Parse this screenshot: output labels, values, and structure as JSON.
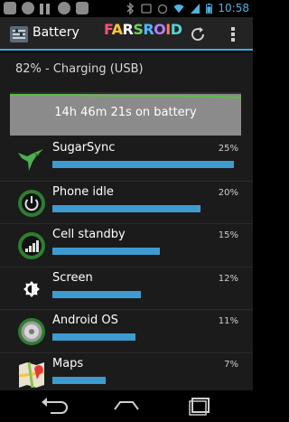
{
  "status_bar": {
    "time": "10:58",
    "colors": {
      "time": "#4fb3e0"
    }
  },
  "action_bar": {
    "title": "Battery",
    "logo_text": [
      "F",
      "A",
      "R",
      "S",
      "R",
      "O",
      "I",
      "D"
    ],
    "accent": "#33b5e5"
  },
  "summary": {
    "status": "82% - Charging (USB)",
    "graph_label": "14h 46m 21s on battery"
  },
  "usage": [
    {
      "label": "SugarSync",
      "percent": "25%",
      "fill": 0.98,
      "icon": "hummingbird-icon"
    },
    {
      "label": "Phone idle",
      "percent": "20%",
      "fill": 0.8,
      "icon": "power-icon"
    },
    {
      "label": "Cell standby",
      "percent": "15%",
      "fill": 0.58,
      "icon": "signal-icon"
    },
    {
      "label": "Screen",
      "percent": "12%",
      "fill": 0.48,
      "icon": "brightness-icon"
    },
    {
      "label": "Android OS",
      "percent": "11%",
      "fill": 0.45,
      "icon": "android-os-icon"
    },
    {
      "label": "Maps",
      "percent": "7%",
      "fill": 0.29,
      "icon": "maps-icon"
    }
  ],
  "colors": {
    "bar": "#3d9bd0",
    "graph_bg": "#8b8b8b",
    "graph_line": "#58c040"
  }
}
